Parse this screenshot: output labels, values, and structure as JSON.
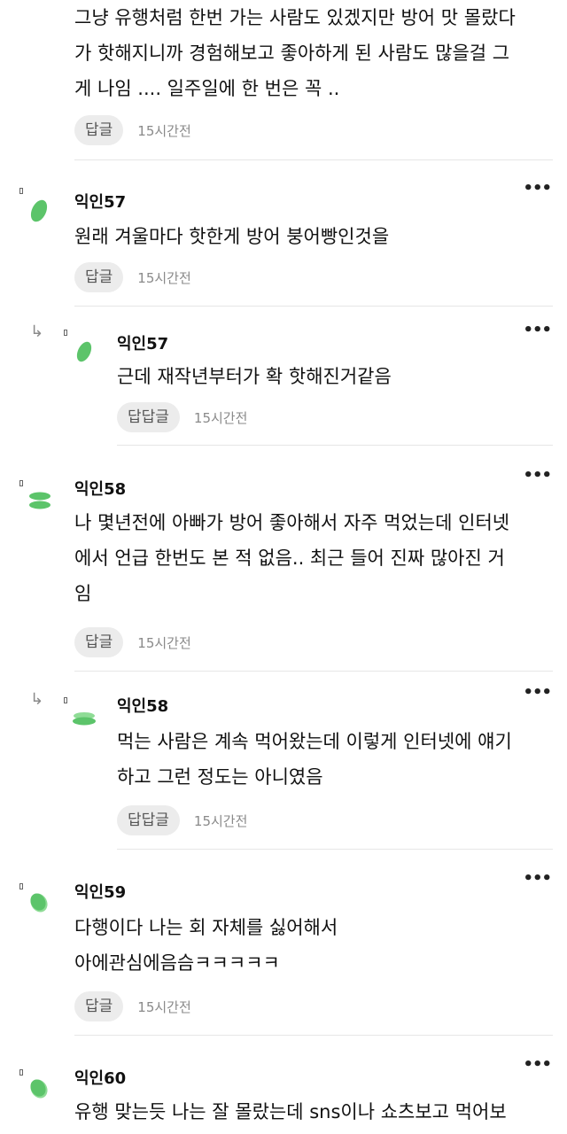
{
  "comments": [
    {
      "nick": "",
      "lines": [
        "그냥 유행처럼 한번 가는 사람도 있겠지만 방어 맛 몰랐다",
        "가 핫해지니까 경험해보고 좋아하게 된 사람도 많을걸 그",
        "게 나임 .... 일주일에 한 번은 꼭 .."
      ],
      "reply_label": "답글",
      "time": "15시간전"
    },
    {
      "nick": "익인57",
      "lines": [
        "원래 겨울마다 핫한게 방어 붕어빵인것을"
      ],
      "reply_label": "답글",
      "time": "15시간전"
    },
    {
      "nick": "익인57",
      "lines": [
        "근데 재작년부터가 확 핫해진거같음"
      ],
      "reply_label": "답답글",
      "time": "15시간전"
    },
    {
      "nick": "익인58",
      "lines": [
        "나 몇년전에 아빠가 방어 좋아해서 자주 먹었는데 인터넷",
        "에서 언급 한번도 본 적 없음.. 최근 들어 진짜 많아진 거",
        "임"
      ],
      "reply_label": "답글",
      "time": "15시간전"
    },
    {
      "nick": "익인58",
      "lines": [
        "먹는 사람은 계속 먹어왔는데 이렇게 인터넷에 얘기",
        "하고 그런 정도는 아니였음"
      ],
      "reply_label": "답답글",
      "time": "15시간전"
    },
    {
      "nick": "익인59",
      "lines": [
        "다행이다 나는 회 자체를 싫어해서",
        "아에관심에음슴ㅋㅋㅋㅋㅋ"
      ],
      "reply_label": "답글",
      "time": "15시간전"
    },
    {
      "nick": "익인60",
      "lines": [
        "유행 맞는듯 나는 잘 몰랐는데 sns이나 쇼츠보고 먹어보"
      ],
      "reply_label": "",
      "time": ""
    }
  ],
  "more_label": "•••",
  "reply_arrow": "↳",
  "colors": {
    "avatar_green": "#5cc46a",
    "avatar_light": "#8fdc96"
  }
}
